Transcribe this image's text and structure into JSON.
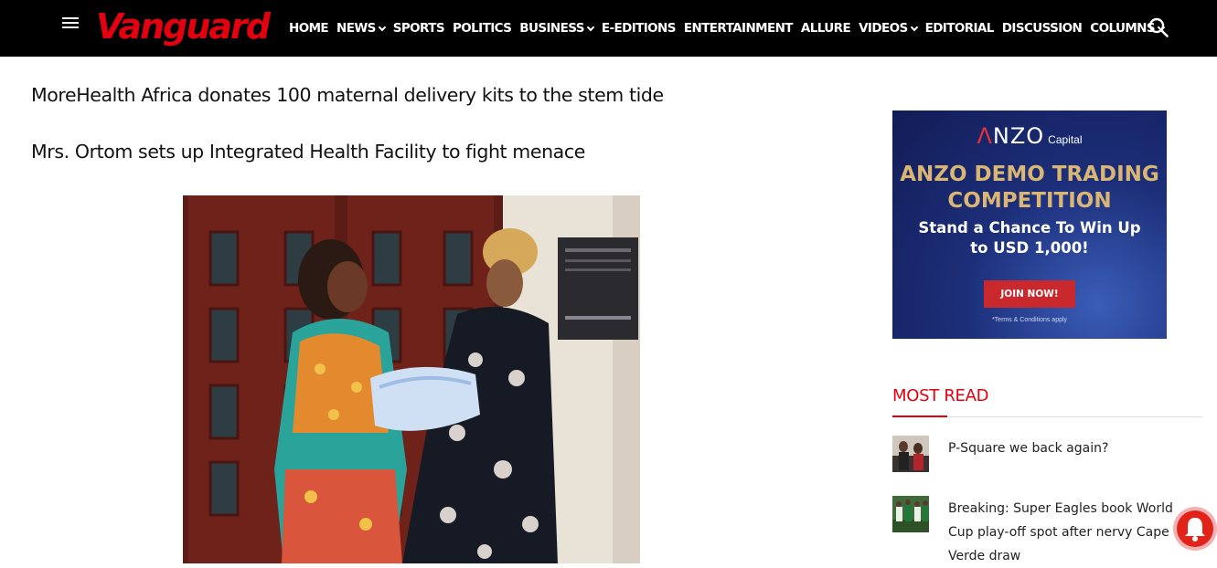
{
  "header": {
    "logo": "Vanguard",
    "nav": [
      {
        "label": "HOME",
        "dropdown": false
      },
      {
        "label": "NEWS",
        "dropdown": true
      },
      {
        "label": "SPORTS",
        "dropdown": false
      },
      {
        "label": "POLITICS",
        "dropdown": false
      },
      {
        "label": "BUSINESS",
        "dropdown": true
      },
      {
        "label": "E-EDITIONS",
        "dropdown": false
      },
      {
        "label": "ENTERTAINMENT",
        "dropdown": false
      },
      {
        "label": "ALLURE",
        "dropdown": false
      },
      {
        "label": "VIDEOS",
        "dropdown": true
      },
      {
        "label": "EDITORIAL",
        "dropdown": false
      },
      {
        "label": "DISCUSSION",
        "dropdown": false
      },
      {
        "label": "COLUMNS",
        "dropdown": true
      }
    ]
  },
  "main": {
    "headlines": [
      "MoreHealth Africa donates 100 maternal delivery kits to the stem tide",
      "Mrs. Ortom sets up Integrated Health Facility to fight menace"
    ]
  },
  "ad": {
    "brand_prefix": "Λ",
    "brand_main": "NZO",
    "brand_suffix": "Capital",
    "title_line1": "ANZO DEMO TRADING",
    "title_line2": "COMPETITION",
    "sub_line1": "Stand a Chance To Win Up",
    "sub_line2": "to USD 1,000!",
    "button": "JOIN NOW!",
    "terms": "*Terms & Conditions apply"
  },
  "most_read": {
    "title": "MOST READ",
    "items": [
      {
        "title": "P-Square we back again?"
      },
      {
        "title": "Breaking: Super Eagles book World Cup play-off spot after nervy Cape Verde draw"
      }
    ]
  },
  "colors": {
    "brand_red": "#e3000f",
    "header_bg": "#000000",
    "ad_gold": "#d9b673",
    "ad_button": "#c9282d"
  },
  "icons": {
    "menu": "hamburger-menu-icon",
    "search": "search-icon",
    "notification": "bell-icon"
  }
}
